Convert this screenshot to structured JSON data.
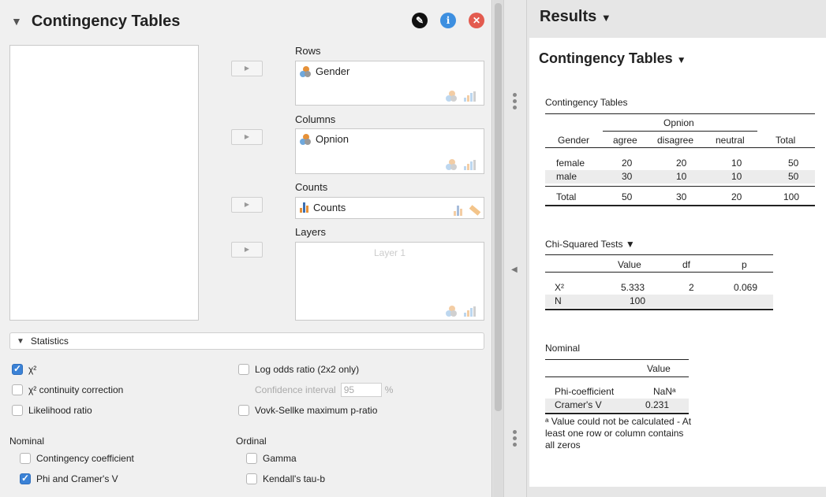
{
  "left_panel": {
    "title": "Contingency Tables",
    "icons": {
      "edit": "pencil-icon",
      "info": "info-icon",
      "close": "close-icon"
    },
    "rows": {
      "label": "Rows",
      "items": [
        "Gender"
      ]
    },
    "columns": {
      "label": "Columns",
      "items": [
        "Opnion"
      ]
    },
    "counts": {
      "label": "Counts",
      "items": [
        "Counts"
      ]
    },
    "layers": {
      "label": "Layers",
      "placeholder": "Layer 1"
    },
    "statistics_section": "Statistics",
    "options": {
      "chi2": "χ²",
      "chi2_continuity": "χ² continuity correction",
      "likelihood_ratio": "Likelihood ratio",
      "log_odds": "Log odds ratio (2x2 only)",
      "confidence_interval": "Confidence interval",
      "ci_value": "95",
      "ci_unit": "%",
      "vovk_sellke": "Vovk-Sellke maximum p-ratio"
    },
    "nominal": {
      "label": "Nominal",
      "contingency_coefficient": "Contingency coefficient",
      "phi_cramers_v": "Phi and Cramer's V"
    },
    "ordinal": {
      "label": "Ordinal",
      "gamma": "Gamma",
      "kendall": "Kendall's tau-b"
    },
    "checked": {
      "chi2": true,
      "chi2_continuity": false,
      "likelihood_ratio": false,
      "log_odds": false,
      "vovk_sellke": false,
      "contingency_coefficient": false,
      "phi_cramers_v": true,
      "gamma": false,
      "kendall": false
    }
  },
  "results": {
    "title": "Results",
    "section_title": "Contingency Tables",
    "contingency_table": {
      "caption": "Contingency Tables",
      "spanner": "Opnion",
      "headers": [
        "Gender",
        "agree",
        "disagree",
        "neutral",
        "Total"
      ],
      "rows": [
        [
          "female",
          "20",
          "20",
          "10",
          "50"
        ],
        [
          "male",
          "30",
          "10",
          "10",
          "50"
        ],
        [
          "Total",
          "50",
          "30",
          "20",
          "100"
        ]
      ]
    },
    "chi_squared": {
      "caption": "Chi-Squared Tests",
      "headers": [
        "",
        "Value",
        "df",
        "p"
      ],
      "rows": [
        [
          "Χ²",
          "5.333",
          "2",
          "0.069"
        ],
        [
          "N",
          "100",
          "",
          ""
        ]
      ]
    },
    "nominal_table": {
      "caption": "Nominal",
      "headers": [
        "",
        "Value"
      ],
      "rows": [
        [
          "Phi-coefficient",
          "NaNᵃ"
        ],
        [
          "Cramer's V",
          "0.231"
        ]
      ]
    },
    "footnote": "ᵃ Value could not be calculated - At least one row or column contains all zeros"
  }
}
